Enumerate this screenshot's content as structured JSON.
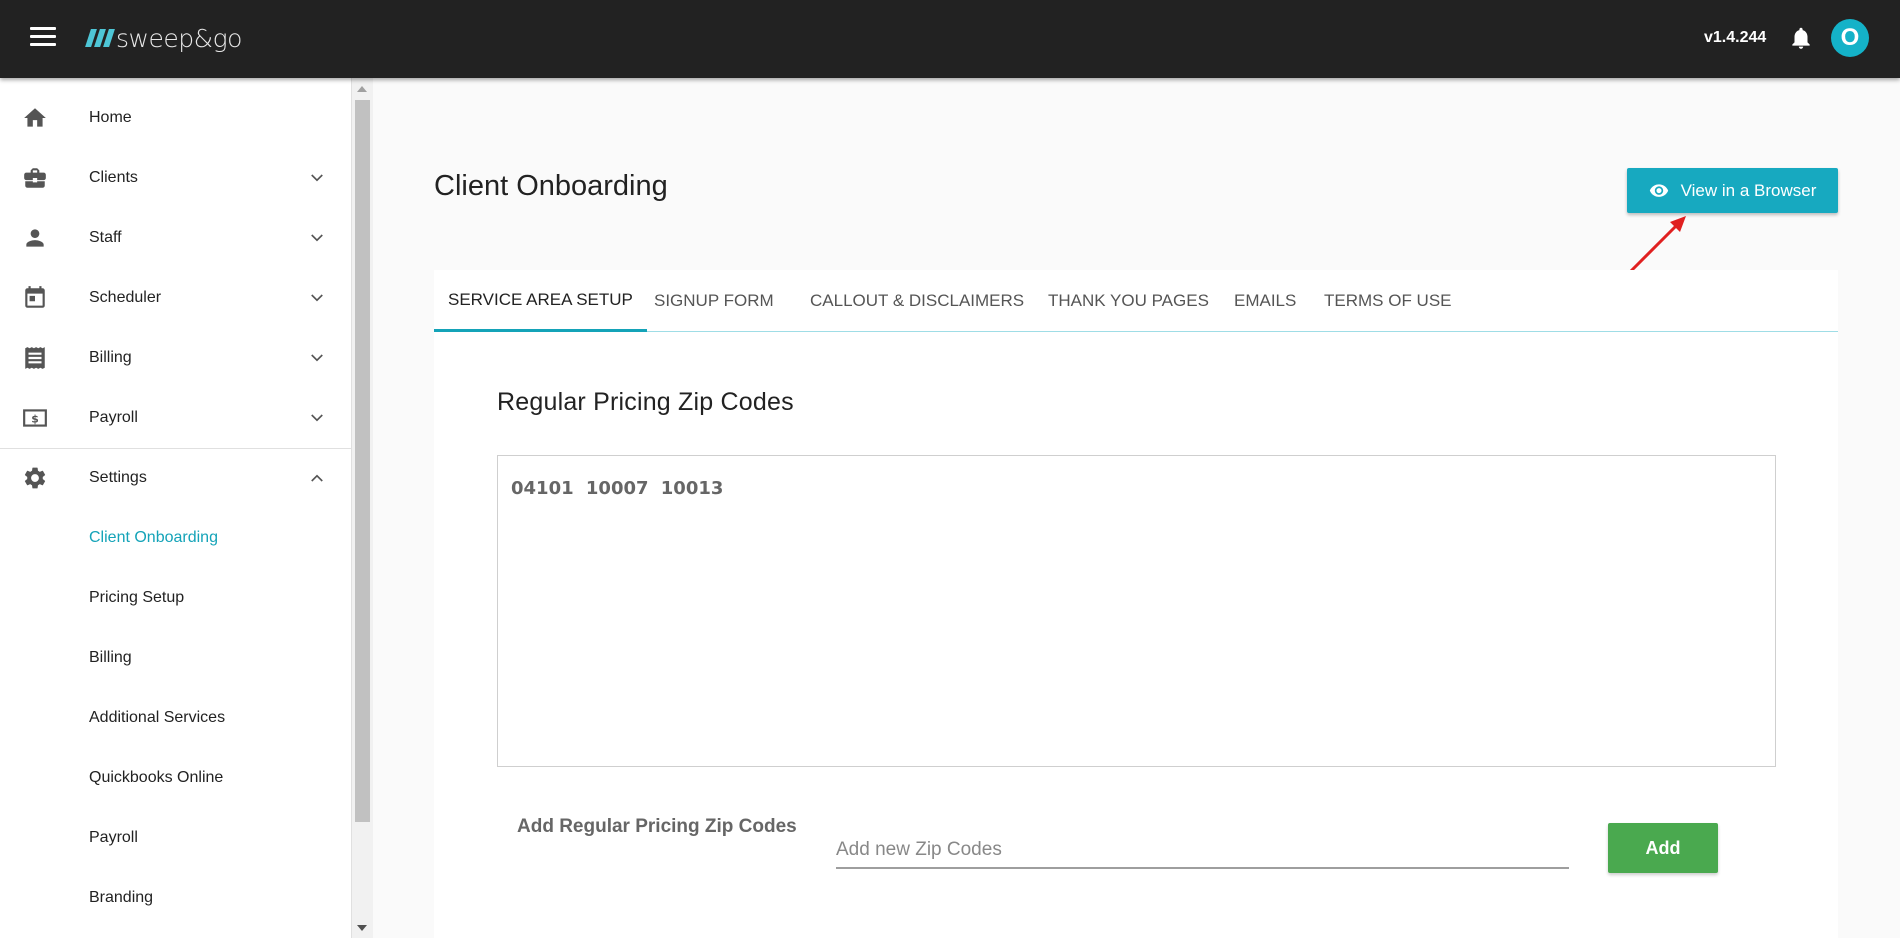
{
  "header": {
    "brand": "sweep&go",
    "version": "v1.4.244",
    "avatar_initial": "O"
  },
  "sidebar": {
    "items": [
      {
        "label": "Home",
        "icon": "home-icon"
      },
      {
        "label": "Clients",
        "icon": "briefcase-icon"
      },
      {
        "label": "Staff",
        "icon": "person-icon"
      },
      {
        "label": "Scheduler",
        "icon": "calendar-icon"
      },
      {
        "label": "Billing",
        "icon": "receipt-icon"
      },
      {
        "label": "Payroll",
        "icon": "money-icon"
      },
      {
        "label": "Settings",
        "icon": "gear-icon"
      }
    ],
    "settings_subitems": [
      {
        "label": "Client Onboarding",
        "active": true
      },
      {
        "label": "Pricing Setup"
      },
      {
        "label": "Billing"
      },
      {
        "label": "Additional Services"
      },
      {
        "label": "Quickbooks Online"
      },
      {
        "label": "Payroll"
      },
      {
        "label": "Branding"
      }
    ]
  },
  "main": {
    "title": "Client Onboarding",
    "view_button_label": "View in a Browser",
    "tabs": [
      {
        "label": "SERVICE AREA SETUP",
        "active": true
      },
      {
        "label": "SIGNUP FORM"
      },
      {
        "label": "CALLOUT & DISCLAIMERS"
      },
      {
        "label": "THANK YOU PAGES"
      },
      {
        "label": "EMAILS"
      },
      {
        "label": "TERMS OF USE"
      }
    ],
    "section_title": "Regular Pricing Zip Codes",
    "zip_codes": "04101 10007 10013",
    "add_label": "Add Regular Pricing Zip Codes",
    "add_placeholder": "Add new Zip Codes",
    "add_button_label": "Add"
  },
  "colors": {
    "topbar": "#222222",
    "accent": "#14a3b8",
    "button_teal": "#17a9c0",
    "button_green": "#4aa94f",
    "annotation_arrow": "#e02020"
  }
}
